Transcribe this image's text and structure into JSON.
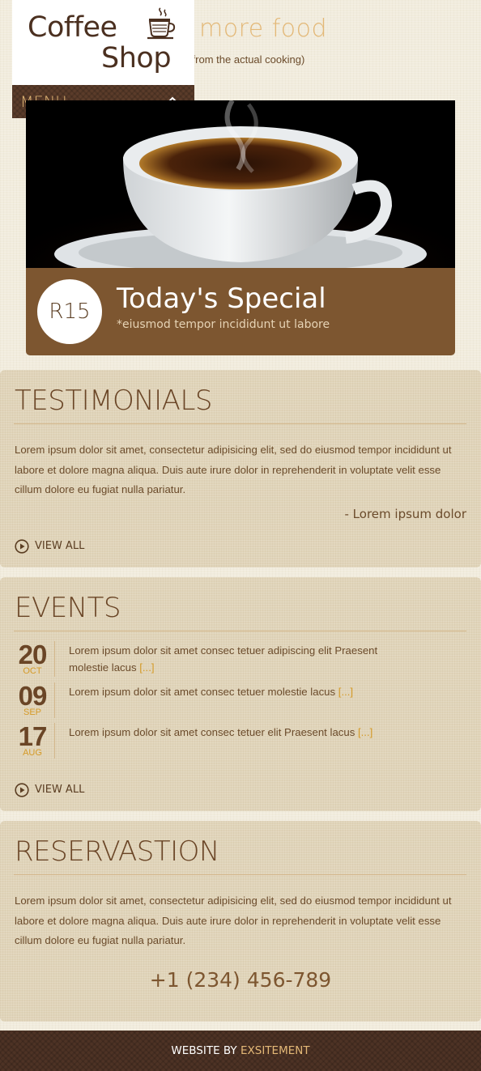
{
  "hero": {
    "title": "more food",
    "subtitle": "rt from the actual cooking)"
  },
  "logo": {
    "line1": "Coffee",
    "line2": "Shop",
    "icon": "coffee-cup-icon"
  },
  "menu": {
    "label": "MENU",
    "icon": "chevron-up-icon"
  },
  "special": {
    "price": "R15",
    "title": "Today's Special",
    "subtitle": "*eiusmod tempor incididunt ut labore"
  },
  "testimonials": {
    "title": "TESTIMONIALS",
    "text": "Lorem ipsum dolor sit amet, consectetur adipisicing elit, sed do eiusmod tempor incididunt ut labore et dolore magna aliqua. Duis aute irure dolor in reprehenderit in voluptate velit esse cillum dolore eu fugiat nulla pariatur.",
    "author": "- Lorem ipsum dolor",
    "view_all": "VIEW ALL"
  },
  "events": {
    "title": "EVENTS",
    "items": [
      {
        "day": "20",
        "month": "OCT",
        "text": "Lorem ipsum dolor sit amet consec tetuer adipiscing elit Praesent molestie lacus",
        "more": "[...]"
      },
      {
        "day": "09",
        "month": "SEP",
        "text": "Lorem ipsum dolor sit amet consec tetuer molestie lacus",
        "more": "[...]"
      },
      {
        "day": "17",
        "month": "AUG",
        "text": "Lorem ipsum dolor sit amet consec tetuer elit Praesent lacus",
        "more": "[...]"
      }
    ],
    "view_all": "VIEW ALL"
  },
  "reservation": {
    "title": "RESERVASTION",
    "text": "Lorem ipsum dolor sit amet, consectetur adipisicing elit, sed do eiusmod tempor incididunt ut labore et dolore magna aliqua. Duis aute irure dolor in reprehenderit in voluptate velit esse cillum dolore eu fugiat nulla pariatur.",
    "phone": "+1 (234) 456-789"
  },
  "footer": {
    "prefix": "WEBSITE BY",
    "link": "EXSITEMENT"
  },
  "colors": {
    "accent": "#d59a27",
    "brown": "#7d5630",
    "dark_brown": "#4e3325",
    "panel": "#e0d4b9",
    "heading_gold": "#e3b877"
  }
}
